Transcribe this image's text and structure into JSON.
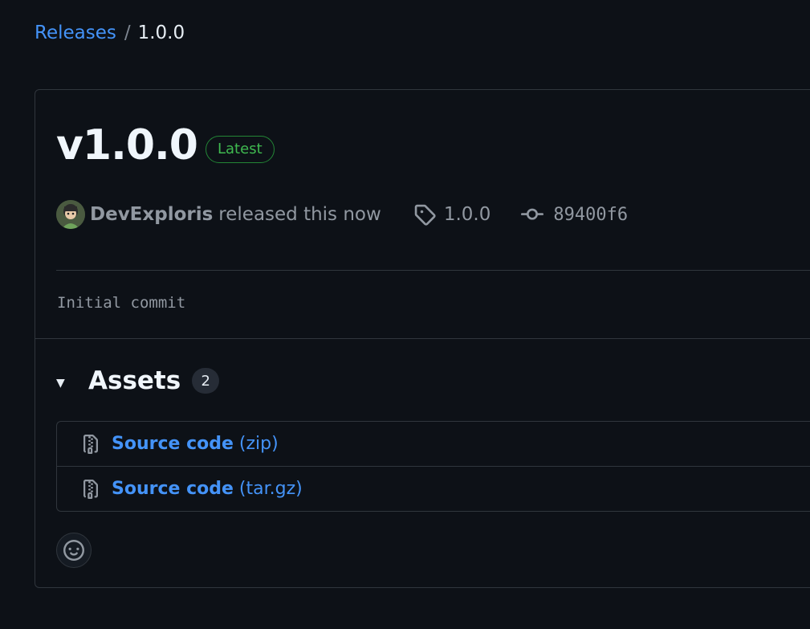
{
  "breadcrumb": {
    "parent": "Releases",
    "separator": "/",
    "current": "1.0.0"
  },
  "release": {
    "title": "v1.0.0",
    "badge": "Latest",
    "author": "DevExploris",
    "released_text": "released this now",
    "tag": "1.0.0",
    "commit": "89400f6",
    "body": "Initial commit"
  },
  "assets": {
    "title": "Assets",
    "count": "2",
    "items": [
      {
        "name": "Source code",
        "ext": "(zip)",
        "icon": "file-zip-icon"
      },
      {
        "name": "Source code",
        "ext": "(tar.gz)",
        "icon": "file-zip-icon"
      }
    ]
  },
  "icons": {
    "caret": "triangle-down",
    "tag": "tag-icon",
    "commit": "git-commit-icon",
    "reaction": "smiley-icon"
  },
  "colors": {
    "background": "#0d1117",
    "link": "#4493f8",
    "muted": "#9198a1",
    "border": "#30363d",
    "latest_green": "#3fb950"
  }
}
